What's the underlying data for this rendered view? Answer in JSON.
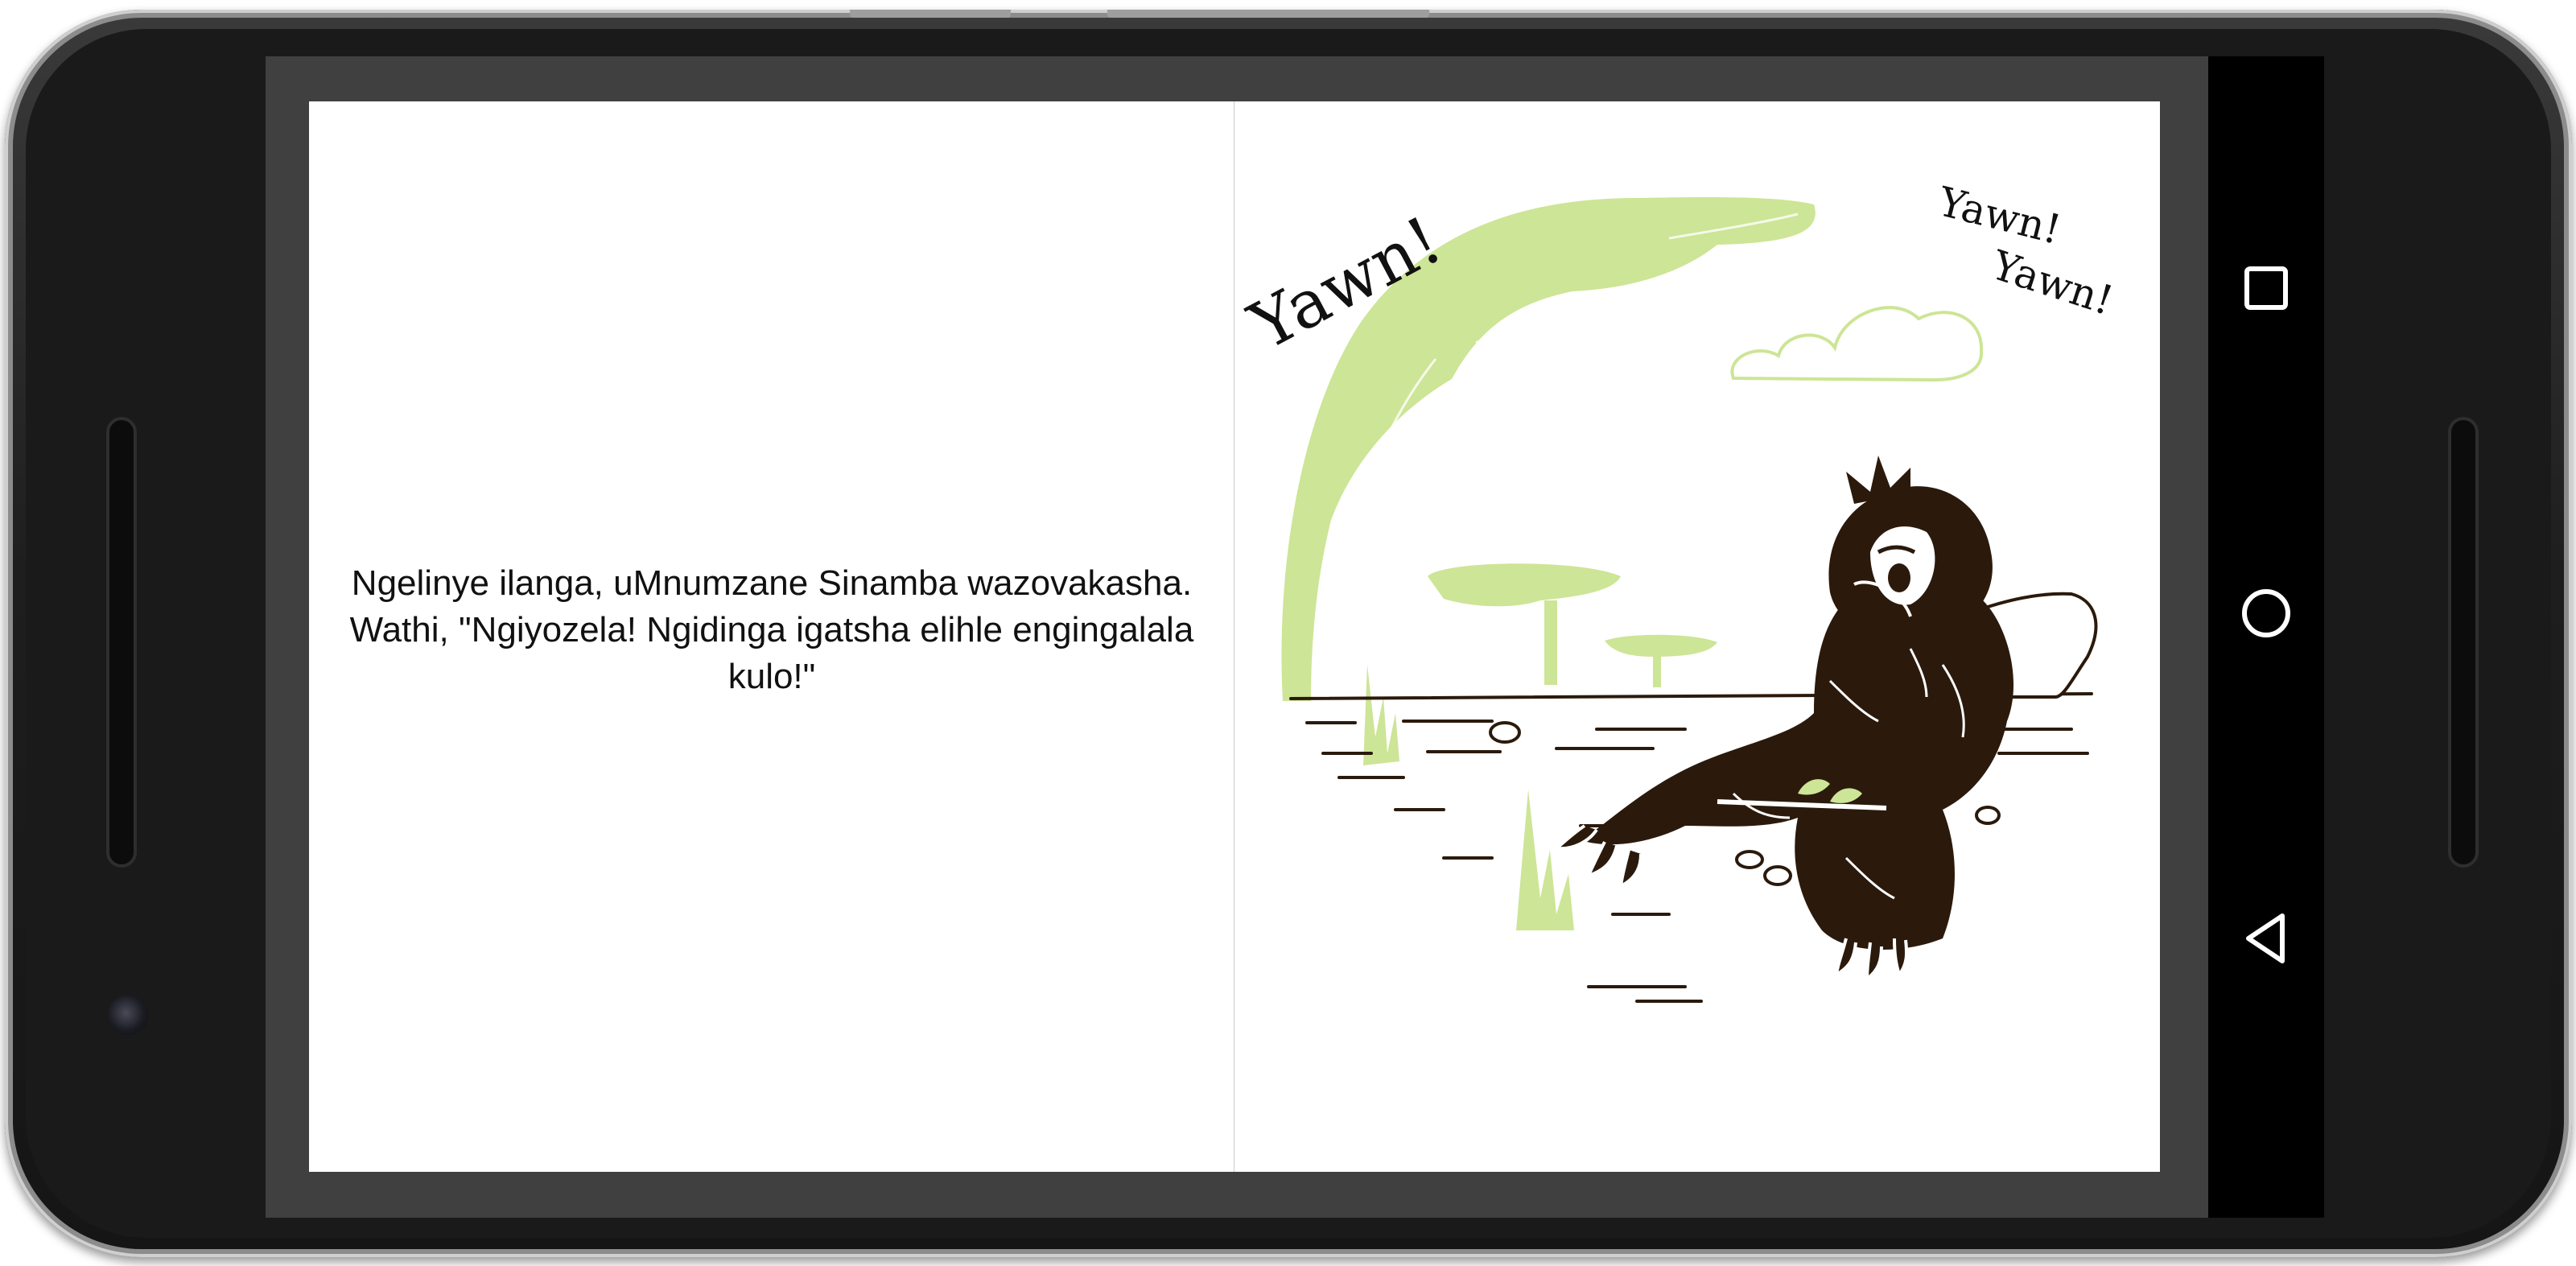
{
  "device": {
    "model": "android phone"
  },
  "book": {
    "left_page": {
      "text": "Ngelinye ilanga, uMnumzane Sinamba wazovakasha. Wathi, \"Ngiyozela! Ngidinga igatsha elihle engingalala kulo!\""
    },
    "right_page": {
      "illustration": "sloth-yawning-illustration",
      "yawn_large": "Yawn!",
      "yawn_small_1": "Yawn!",
      "yawn_small_2": "Yawn!"
    }
  },
  "navbar": {
    "recents_icon": "square-icon",
    "home_icon": "circle-icon",
    "back_icon": "triangle-back-icon"
  },
  "colors": {
    "viewer_background": "#404040",
    "page_background": "#ffffff",
    "illustration_green": "#cde596",
    "illustration_brown": "#2b1a0c",
    "navbar_background": "#000000"
  }
}
